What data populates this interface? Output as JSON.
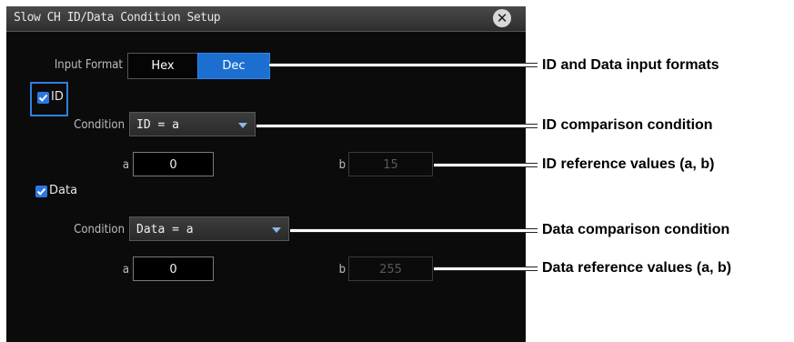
{
  "dialog": {
    "title": "Slow CH ID/Data Condition Setup",
    "close_icon": "close-icon",
    "input_format": {
      "label": "Input Format",
      "options": [
        "Hex",
        "Dec"
      ],
      "selected": "Dec"
    },
    "id_section": {
      "checkbox_label": "ID",
      "checked": true,
      "condition_label": "Condition",
      "condition_value": "ID = a",
      "a_label": "a",
      "a_value": "0",
      "b_label": "b",
      "b_value": "15"
    },
    "data_section": {
      "checkbox_label": "Data",
      "checked": true,
      "condition_label": "Condition",
      "condition_value": "Data = a",
      "a_label": "a",
      "a_value": "0",
      "b_label": "b",
      "b_value": "255"
    }
  },
  "annotations": {
    "input_formats": "ID and Data input formats",
    "id_condition": "ID comparison condition",
    "id_values": "ID reference values (a, b)",
    "data_condition": "Data comparison condition",
    "data_values": "Data reference values (a, b)"
  },
  "colors": {
    "accent": "#1c6fd0",
    "background": "#0b0b0b"
  }
}
